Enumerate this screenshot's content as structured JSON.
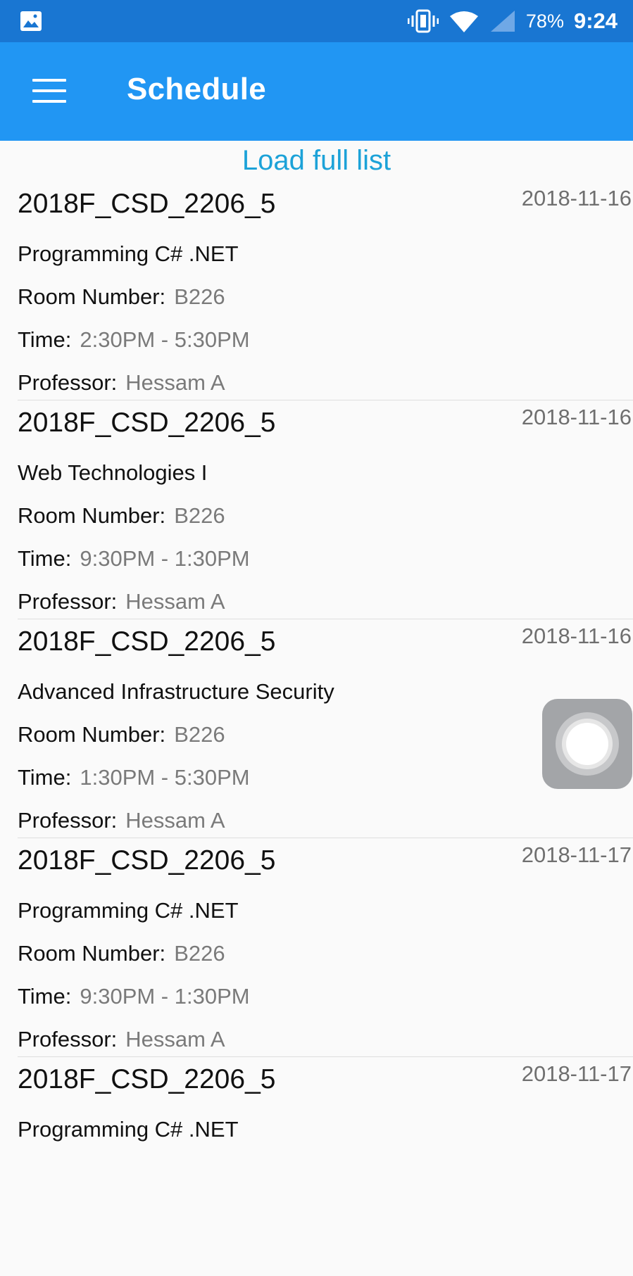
{
  "status_bar": {
    "battery": "78%",
    "time": "9:24",
    "icons": [
      "gallery-icon",
      "vibrate-icon",
      "wifi-icon",
      "signal-icon"
    ]
  },
  "app_bar": {
    "title": "Schedule",
    "menu_icon": "hamburger-menu-icon"
  },
  "load_full_list": "Load full list",
  "labels": {
    "room": "Room Number:",
    "time": "Time:",
    "professor": "Professor:"
  },
  "schedule": [
    {
      "code": "2018F_CSD_2206_5",
      "date": "2018-11-16",
      "course": "Programming C# .NET",
      "room": "B226",
      "time": "2:30PM - 5:30PM",
      "professor": "Hessam A"
    },
    {
      "code": "2018F_CSD_2206_5",
      "date": "2018-11-16",
      "course": "Web Technologies I",
      "room": "B226",
      "time": "9:30PM - 1:30PM",
      "professor": "Hessam A"
    },
    {
      "code": "2018F_CSD_2206_5",
      "date": "2018-11-16",
      "course": "Advanced Infrastructure Security",
      "room": "B226",
      "time": "1:30PM - 5:30PM",
      "professor": "Hessam A"
    },
    {
      "code": "2018F_CSD_2206_5",
      "date": "2018-11-17",
      "course": "Programming C# .NET",
      "room": "B226",
      "time": "9:30PM - 1:30PM",
      "professor": "Hessam A"
    },
    {
      "code": "2018F_CSD_2206_5",
      "date": "2018-11-17",
      "course": "Programming C# .NET",
      "room": "",
      "time": "",
      "professor": ""
    }
  ],
  "colors": {
    "status_bar": "#1976d2",
    "app_bar": "#2196f3",
    "link": "#1ca2d8"
  }
}
